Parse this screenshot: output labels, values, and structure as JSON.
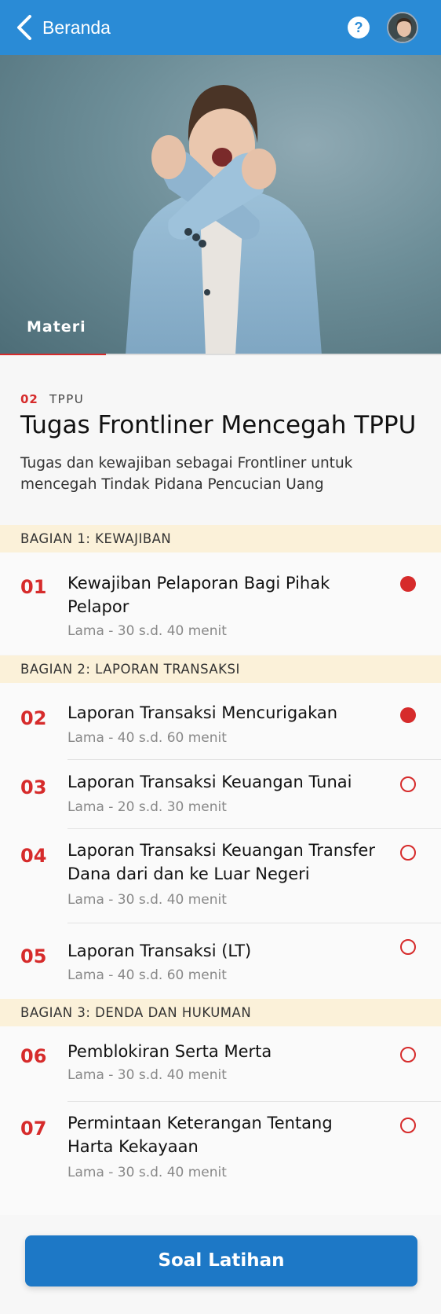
{
  "header": {
    "back_label": "Beranda",
    "help_icon": "?"
  },
  "hero": {
    "tab_label": "Materi",
    "progress_fraction": 0.24
  },
  "module": {
    "number": "02",
    "category": "TPPU",
    "title": "Tugas Frontliner Mencegah TPPU",
    "description": "Tugas dan kewajiban sebagai Frontliner untuk mencegah Tindak Pidana Pencucian Uang"
  },
  "sections": [
    {
      "label": "BAGIAN 1: KEWAJIBAN"
    },
    {
      "label": "BAGIAN 2: LAPORAN TRANSAKSI"
    },
    {
      "label": "BAGIAN 3: DENDA DAN HUKUMAN"
    }
  ],
  "items": [
    {
      "number": "01",
      "title": "Kewajiban Pelaporan Bagi Pihak Pelapor",
      "meta": "Lama - 30 s.d. 40 menit",
      "status": "active"
    },
    {
      "number": "02",
      "title": "Laporan Transaksi Mencurigakan",
      "meta": "Lama - 40 s.d. 60 menit",
      "status": "active"
    },
    {
      "number": "03",
      "title": "Laporan Transaksi Keuangan Tunai",
      "meta": "Lama - 20 s.d. 30 menit",
      "status": "pending"
    },
    {
      "number": "04",
      "title": "Laporan Transaksi Keuangan Transfer Dana dari dan ke Luar Negeri",
      "meta": "Lama - 30 s.d. 40 menit",
      "status": "pending"
    },
    {
      "number": "05",
      "title": "Laporan Transaksi (LT)",
      "meta": "Lama - 40 s.d. 60 menit",
      "status": "pending"
    },
    {
      "number": "06",
      "title": "Pemblokiran Serta Merta",
      "meta": "Lama - 30 s.d. 40 menit",
      "status": "pending"
    },
    {
      "number": "07",
      "title": "Permintaan Keterangan Tentang Harta Kekayaan",
      "meta": "Lama - 30 s.d. 40 menit",
      "status": "pending"
    }
  ],
  "cta": {
    "label": "Soal Latihan"
  },
  "colors": {
    "brand_blue": "#2a8bd6",
    "accent_red": "#d62b2b",
    "section_bg": "#fbf1d9"
  }
}
